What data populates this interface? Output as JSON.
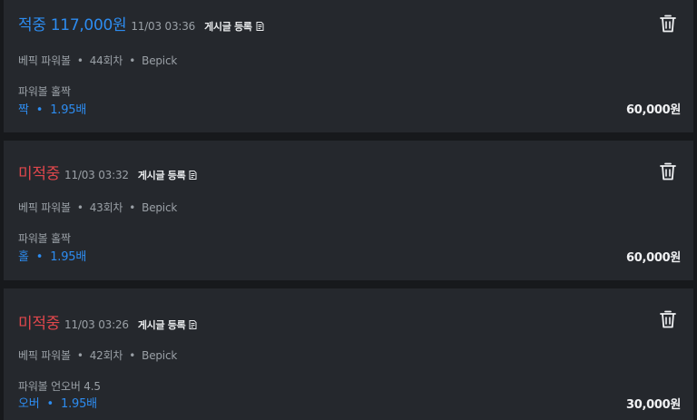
{
  "colors": {
    "win": "#2d8cf0",
    "pending": "#e0474c",
    "card_background": "#25282d",
    "page_background": "#17191c"
  },
  "post_label": "게시글 등록",
  "icons": {
    "post": "pencil-document-icon",
    "delete": "trash-icon"
  },
  "bets": [
    {
      "status": "적중 117,000원",
      "status_type": "win",
      "time": "11/03 03:36",
      "game": "베픽 파워볼",
      "round": "44회차",
      "site": "Bepick",
      "market": "파워볼 홀짝",
      "pick": "짝",
      "odds": "1.95배",
      "amount": "60,000원"
    },
    {
      "status": "미적중",
      "status_type": "pending",
      "time": "11/03 03:32",
      "game": "베픽 파워볼",
      "round": "43회차",
      "site": "Bepick",
      "market": "파워볼 홀짝",
      "pick": "홀",
      "odds": "1.95배",
      "amount": "60,000원"
    },
    {
      "status": "미적중",
      "status_type": "pending",
      "time": "11/03 03:26",
      "game": "베픽 파워볼",
      "round": "42회차",
      "site": "Bepick",
      "market": "파워볼 언오버 4.5",
      "pick": "오버",
      "odds": "1.95배",
      "amount": "30,000원"
    }
  ]
}
